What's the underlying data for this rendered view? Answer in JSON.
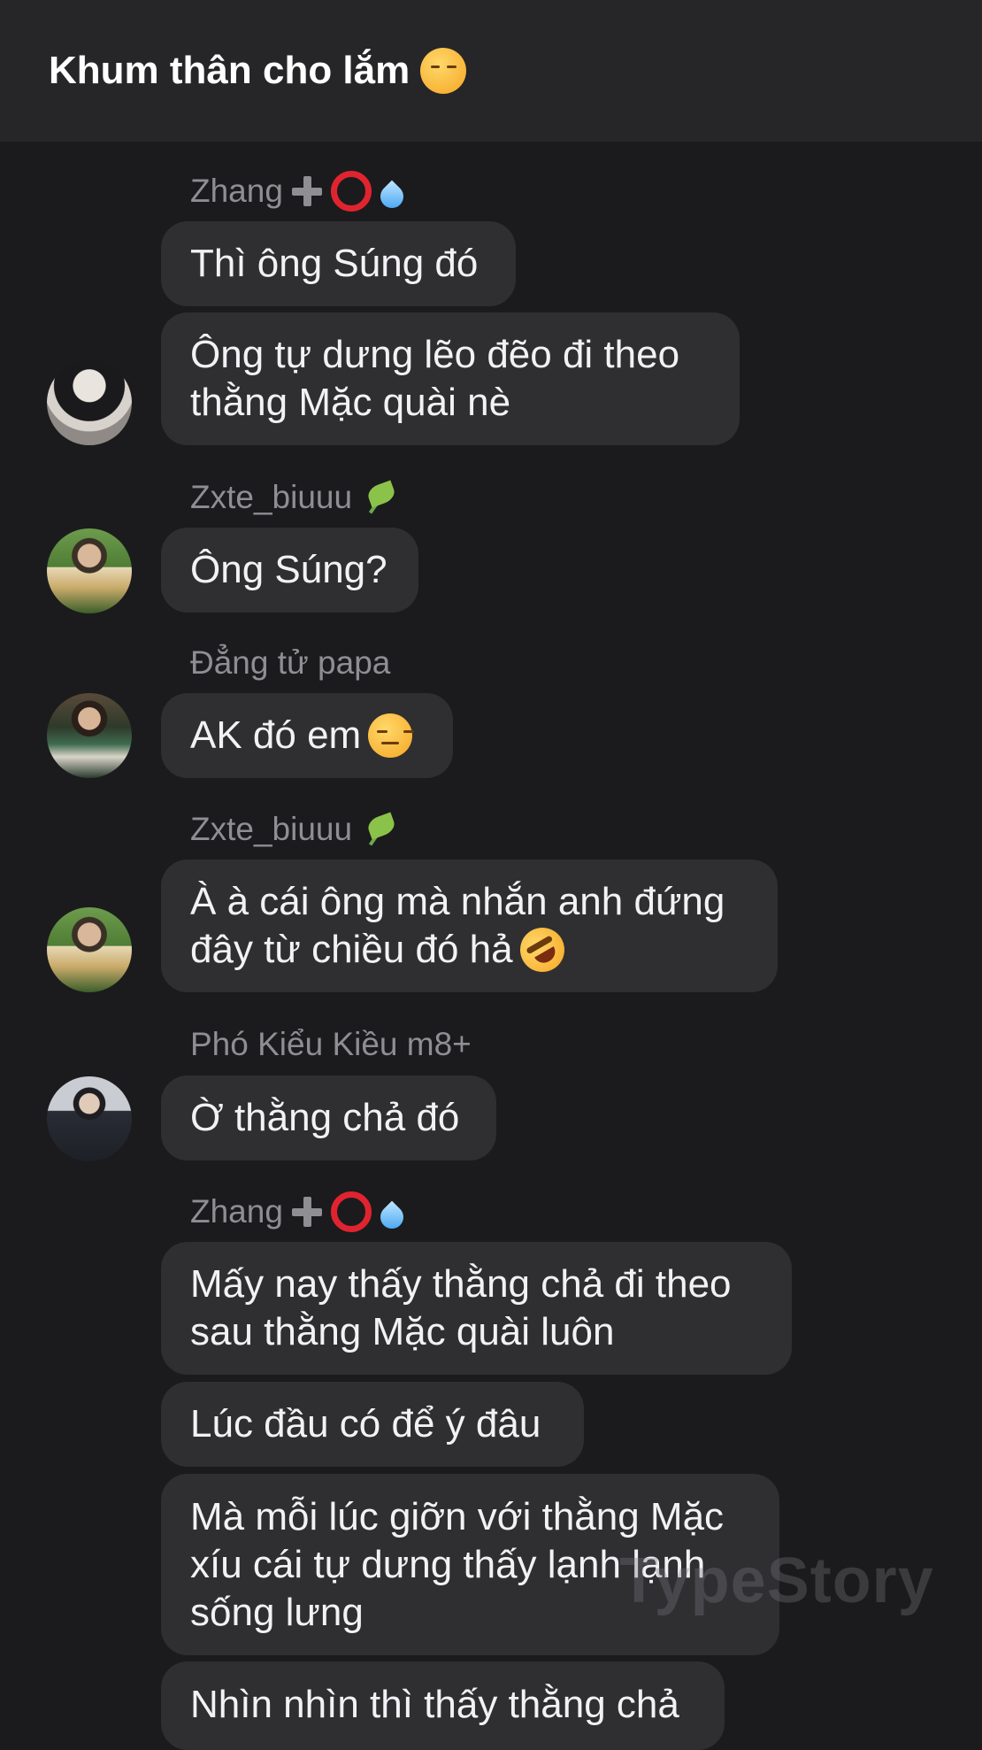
{
  "header": {
    "title": "Khum thân cho lắm",
    "title_emoji": "unamused-face"
  },
  "senders": {
    "zhang": "Zhang",
    "zxte": "Zxte_biuuu",
    "dang": "Đẳng tử papa",
    "pho": "Phó Kiểu Kiều m8+"
  },
  "messages": {
    "m1": "Thì ông Súng đó",
    "m2_l1": "Ông tự dưng lẽo đẽo đi theo",
    "m2_l2": "thằng Mặc quài nè",
    "m3": "Ông Súng?",
    "m4": "AK đó em",
    "m5_l1": "À à cái ông mà nhắn anh đứng",
    "m5_l2": "đây từ chiều đó hả",
    "m6": "Ờ thằng chả đó",
    "m7_l1": "Mấy nay thấy thằng chả đi theo",
    "m7_l2": "sau thằng Mặc quài luôn",
    "m8": "Lúc đầu có để ý đâu",
    "m9_l1": "Mà mỗi lúc giỡn với thằng Mặc",
    "m9_l2": "xíu cái tự dưng thấy lạnh lạnh",
    "m9_l3": "sống lưng",
    "m10_l1": "Nhìn nhìn thì thấy thằng chả"
  },
  "watermark": "TypeStory"
}
